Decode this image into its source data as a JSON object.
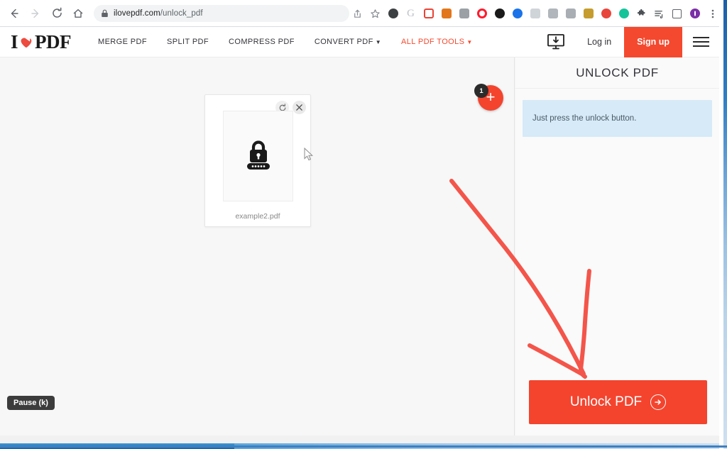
{
  "browser": {
    "back_icon": "back-arrow-icon",
    "forward_icon": "forward-arrow-icon",
    "reload_icon": "reload-icon",
    "home_icon": "home-icon",
    "site_lock_icon": "padlock-icon",
    "url_host": "ilovepdf.com",
    "url_path": "/unlock_pdf",
    "menu_icon": "kebab-menu-icon",
    "extensions": [
      {
        "name": "share-icon",
        "glyph": "share",
        "color": "#5f6368"
      },
      {
        "name": "bookmark-star-icon",
        "glyph": "star",
        "color": "#5f6368"
      },
      {
        "name": "extension-dark-circle",
        "glyph": "circle",
        "color": "#3c4043"
      },
      {
        "name": "google-g-icon",
        "glyph": "g",
        "color": "#bdc1c6"
      },
      {
        "name": "extension-red-square",
        "glyph": "square",
        "color": "#ea4335"
      },
      {
        "name": "metamask-fox-icon",
        "glyph": "square",
        "color": "#e2761b"
      },
      {
        "name": "extension-gray-square",
        "glyph": "square",
        "color": "#9aa0a6"
      },
      {
        "name": "opera-o-icon",
        "glyph": "circle",
        "color": "#ff1b2d"
      },
      {
        "name": "extension-black-circle",
        "glyph": "circle",
        "color": "#1a1a1a"
      },
      {
        "name": "extension-blue-circle",
        "glyph": "circle",
        "color": "#1a73e8"
      },
      {
        "name": "extension-pale-square",
        "glyph": "square",
        "color": "#cfd4d9"
      },
      {
        "name": "extension-mail-square",
        "glyph": "square",
        "color": "#b0b6bb"
      },
      {
        "name": "extension-chat-square",
        "glyph": "square",
        "color": "#a8aeb4"
      },
      {
        "name": "extension-gold-square",
        "glyph": "square",
        "color": "#c69c2e"
      },
      {
        "name": "extension-red-oval",
        "glyph": "circle",
        "color": "#e8453c"
      },
      {
        "name": "grammarly-g-icon",
        "glyph": "circle",
        "color": "#15c39a"
      },
      {
        "name": "puzzle-extensions-icon",
        "glyph": "puzzle",
        "color": "#4d5156"
      },
      {
        "name": "reading-list-icon",
        "glyph": "list",
        "color": "#4d5156"
      },
      {
        "name": "sidebar-toggle-icon",
        "glyph": "outline",
        "color": "#4d5156"
      },
      {
        "name": "profile-avatar-icon",
        "glyph": "circle",
        "color": "#7b2ea8"
      }
    ]
  },
  "site": {
    "logo": {
      "first": "I",
      "heart_icon": "heart-icon",
      "last": "PDF"
    },
    "nav": [
      {
        "label": "MERGE PDF",
        "accent": false,
        "has_caret": false
      },
      {
        "label": "SPLIT PDF",
        "accent": false,
        "has_caret": false
      },
      {
        "label": "COMPRESS PDF",
        "accent": false,
        "has_caret": false
      },
      {
        "label": "CONVERT PDF",
        "accent": false,
        "has_caret": true
      },
      {
        "label": "ALL PDF TOOLS",
        "accent": true,
        "has_caret": true
      }
    ],
    "desktop_app_icon": "desktop-download-icon",
    "login_label": "Log in",
    "signup_label": "Sign up",
    "menu_icon": "hamburger-menu-icon"
  },
  "workspace": {
    "file": {
      "name": "example2.pdf",
      "thumb_icon": "locked-pdf-icon",
      "rotate_icon": "rotate-icon",
      "close_icon": "close-icon"
    },
    "add_file": {
      "icon": "plus-icon",
      "badge_count": "1"
    },
    "cursor_icon": "mouse-pointer-icon"
  },
  "panel": {
    "title": "UNLOCK PDF",
    "info_text": "Just press the unlock button.",
    "action_label": "Unlock PDF",
    "action_icon": "arrow-right-circle-icon"
  },
  "overlay": {
    "pause_label": "Pause (k)",
    "annotation_icon": "red-arrow-annotation",
    "annotation_color": "#f4554a"
  },
  "colors": {
    "brand_red": "#f4442e",
    "accent_red": "#f4492e",
    "info_blue": "#d6eaf7",
    "workspace_bg": "#f7f7f7",
    "panel_bg": "#fafafa"
  }
}
